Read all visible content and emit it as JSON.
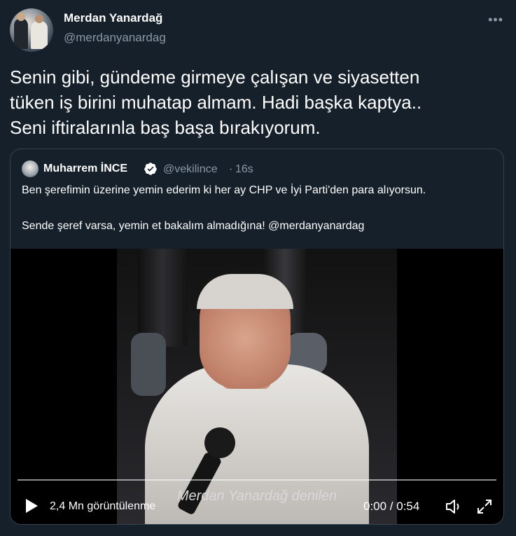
{
  "tweet": {
    "author_name": "Merdan Yanardağ",
    "author_handle": "@merdanyanardag",
    "more_icon": "more-horizontal-icon",
    "text": "Senin gibi, gündeme girmeye çalışan  ve siyasetten\ntüken iş birini muhatap almam. Hadi başka kaptya..\nSeni iftiralarınla baş başa bırakıyorum."
  },
  "quoted_tweet": {
    "author_name": "Muharrem İNCE",
    "verified_icon": "verified-badge-icon",
    "author_handle": "@vekilince",
    "separator": "·",
    "timestamp": "16s",
    "text_line1": "Ben şerefimin üzerine yemin ederim ki her ay CHP ve İyi Parti'den para alıyorsun.",
    "text_line2": "Sende şeref varsa, yemin et bakalım almadığına! @merdanyanardag"
  },
  "video": {
    "subtitle": "Merdan Yanardağ denilen",
    "views": "2,4 Mn görüntülenme",
    "time": "0:00 / 0:54",
    "progress": 0,
    "icons": [
      "play-icon",
      "volume-icon",
      "fullscreen-icon"
    ]
  },
  "colors": {
    "background": "#15202b",
    "secondary_text": "#8b98a5",
    "border": "#38444d",
    "verified": "#ffffff"
  }
}
